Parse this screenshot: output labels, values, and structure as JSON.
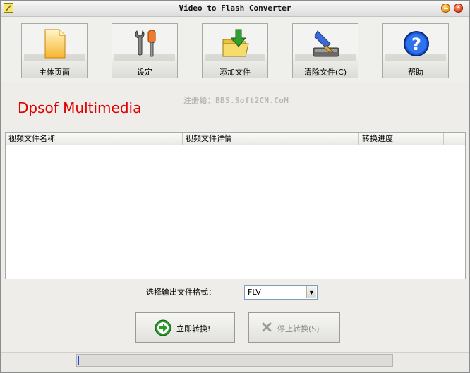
{
  "window": {
    "title": "Video to Flash Converter"
  },
  "toolbar": {
    "items": [
      {
        "label": "主体页面",
        "icon": "page-icon"
      },
      {
        "label": "设定",
        "icon": "tools-icon"
      },
      {
        "label": "添加文件",
        "icon": "add-folder-icon"
      },
      {
        "label": "清除文件(C)",
        "icon": "clear-broom-icon"
      },
      {
        "label": "帮助",
        "icon": "help-icon"
      }
    ]
  },
  "banner": {
    "brand": "Dpsof Multimedia",
    "registered": "注册给：BBS.Soft2CN.CoM"
  },
  "list": {
    "columns": [
      "视频文件名称",
      "视频文件详情",
      "转换进度"
    ],
    "rows": []
  },
  "format": {
    "label": "选择输出文件格式：",
    "selected": "FLV"
  },
  "actions": {
    "convert_label": "立即转换!",
    "stop_label": "停止转换(S)"
  },
  "colors": {
    "brand": "#e00000",
    "registered": "#b8b8b0"
  }
}
